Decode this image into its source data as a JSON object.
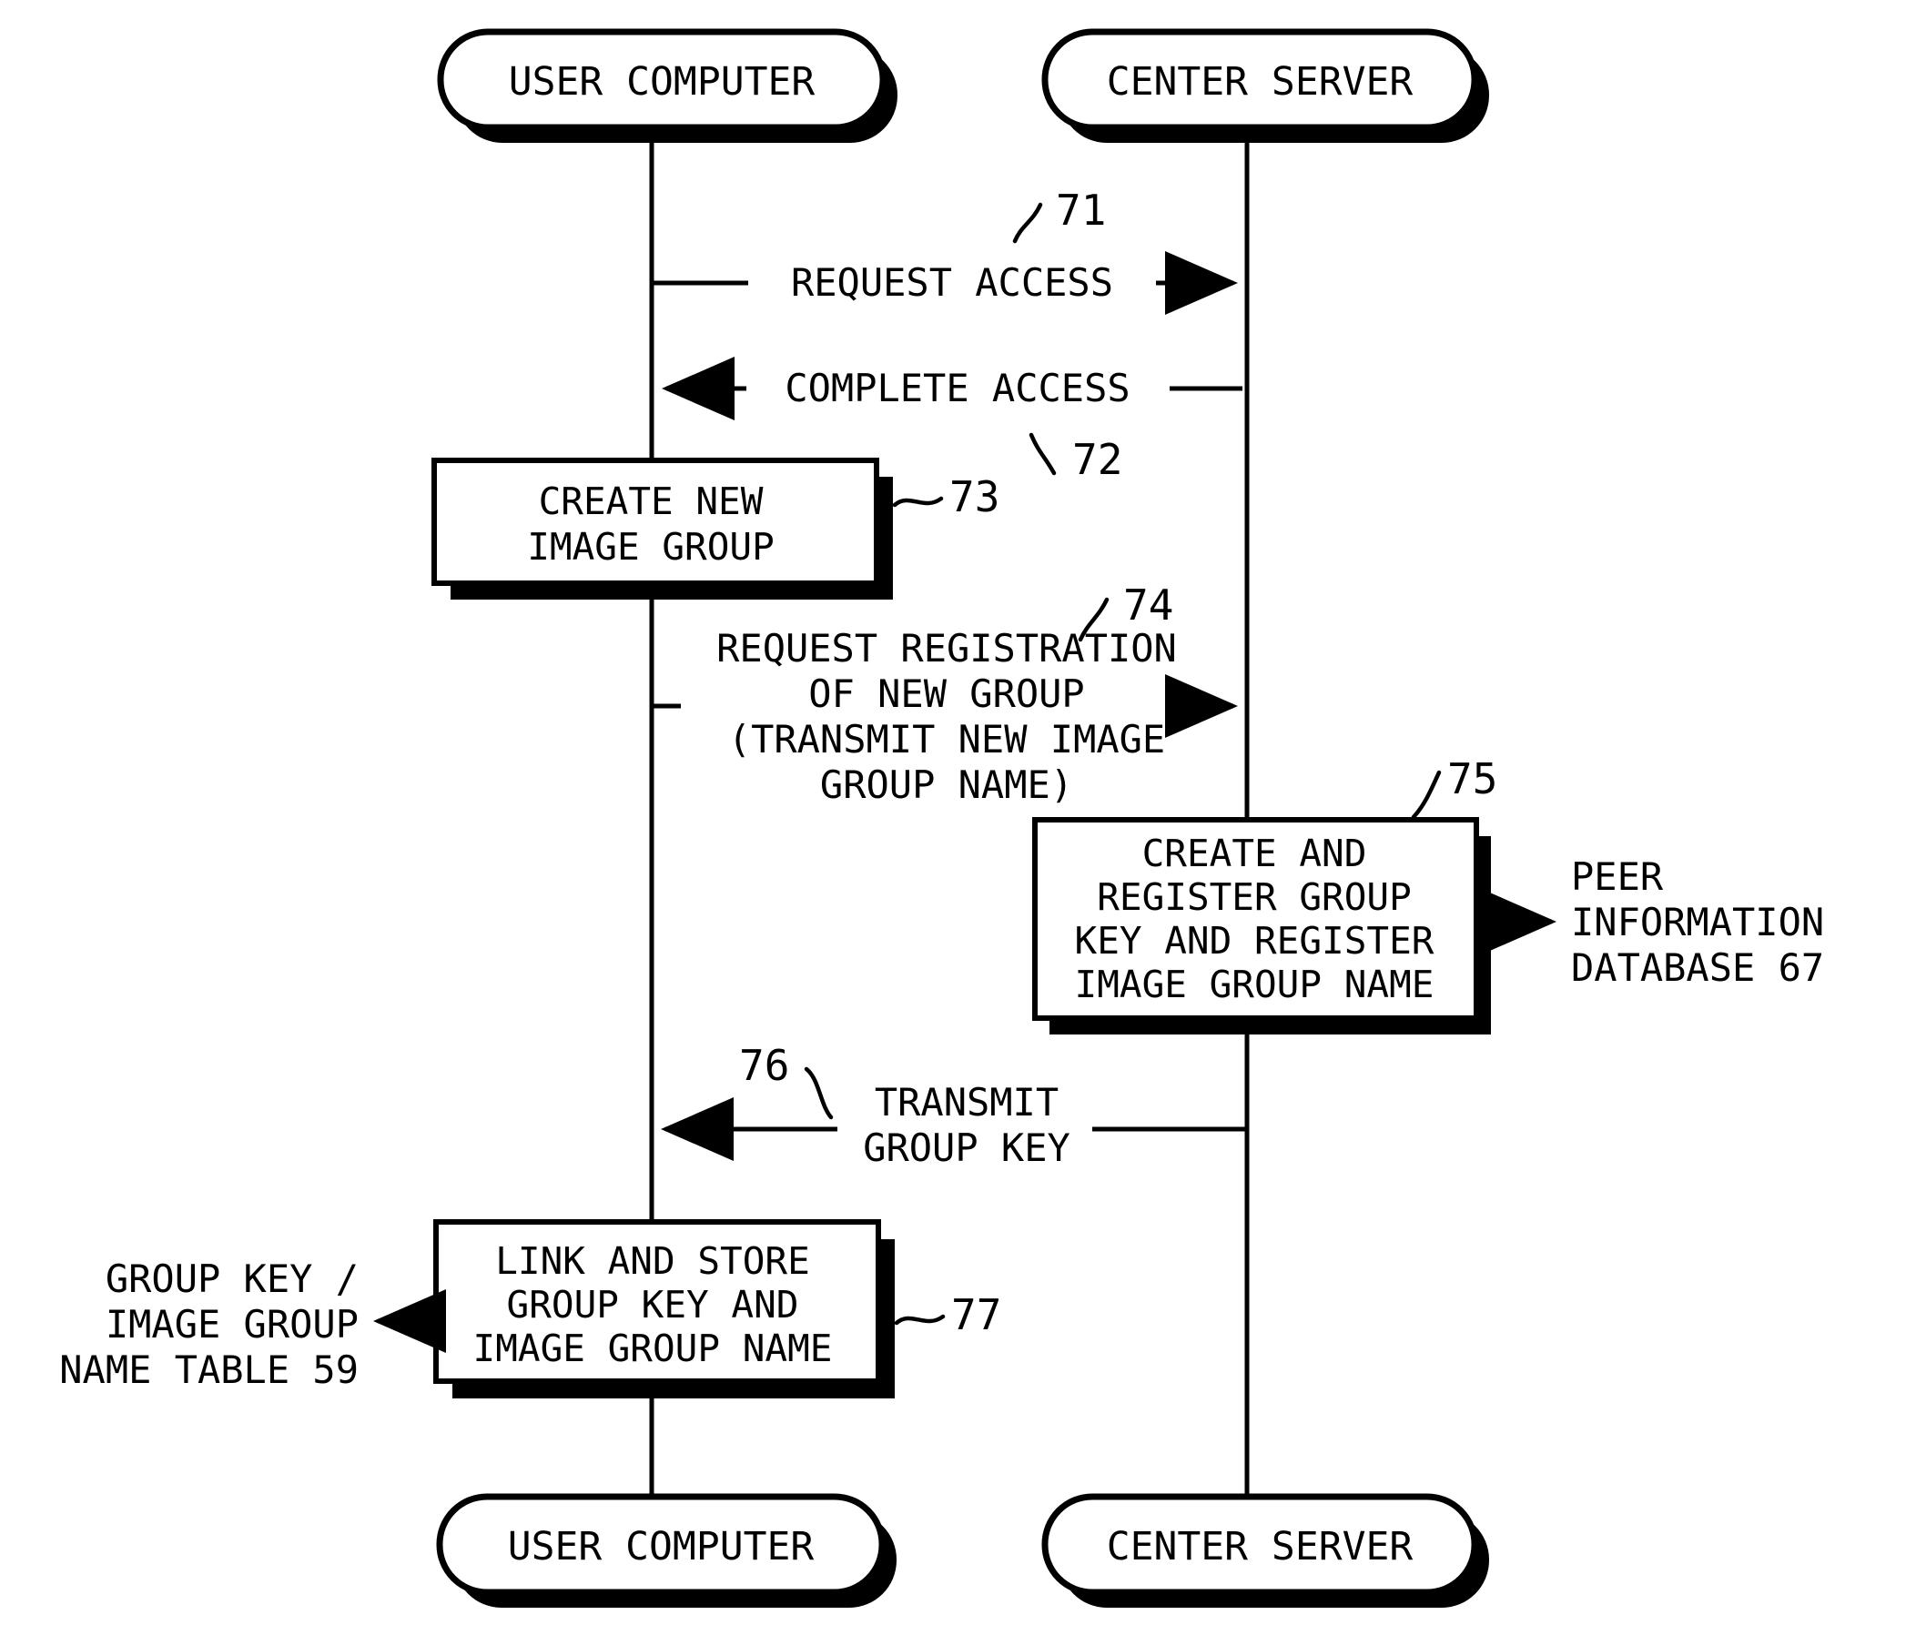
{
  "figure": {
    "type": "patent-sequence-diagram",
    "background_color": "#ffffff",
    "line_color": "#000000"
  },
  "actors": {
    "top": [
      {
        "id": "user-computer-top",
        "label": "USER COMPUTER"
      },
      {
        "id": "center-server-top",
        "label": "CENTER SERVER"
      }
    ],
    "bottom": [
      {
        "id": "user-computer-bottom",
        "label": "USER COMPUTER"
      },
      {
        "id": "center-server-bottom",
        "label": "CENTER SERVER"
      }
    ]
  },
  "messages": [
    {
      "ref": "71",
      "label_lines": [
        "REQUEST ACCESS"
      ],
      "direction": "user-to-server"
    },
    {
      "ref": "72",
      "label_lines": [
        "COMPLETE ACCESS"
      ],
      "direction": "server-to-user"
    },
    {
      "ref": "74",
      "label_lines": [
        "REQUEST REGISTRATION",
        "OF NEW GROUP",
        "(TRANSMIT NEW IMAGE",
        "GROUP NAME)"
      ],
      "direction": "user-to-server"
    },
    {
      "ref": "76",
      "label_lines": [
        "TRANSMIT",
        "GROUP KEY"
      ],
      "direction": "server-to-user"
    }
  ],
  "process_boxes": [
    {
      "ref": "73",
      "lane": "user-computer",
      "lines": [
        "CREATE NEW",
        "IMAGE GROUP"
      ]
    },
    {
      "ref": "75",
      "lane": "center-server",
      "lines": [
        "CREATE AND",
        "REGISTER GROUP",
        "KEY AND REGISTER",
        "IMAGE GROUP NAME"
      ]
    },
    {
      "ref": "77",
      "lane": "user-computer",
      "lines": [
        "LINK AND STORE",
        "GROUP KEY AND",
        "IMAGE GROUP NAME"
      ]
    }
  ],
  "external_stores": [
    {
      "id": "peer-information-database",
      "lines": [
        "PEER",
        "INFORMATION",
        "DATABASE 67"
      ],
      "ref_number": "67",
      "from_box": "75",
      "side": "right"
    },
    {
      "id": "group-key-image-group-name-table",
      "lines": [
        "GROUP KEY /",
        "IMAGE GROUP",
        "NAME TABLE 59"
      ],
      "ref_number": "59",
      "from_box": "77",
      "side": "left"
    }
  ],
  "reference_numerals": [
    "71",
    "72",
    "73",
    "74",
    "75",
    "76",
    "77",
    "67",
    "59"
  ]
}
